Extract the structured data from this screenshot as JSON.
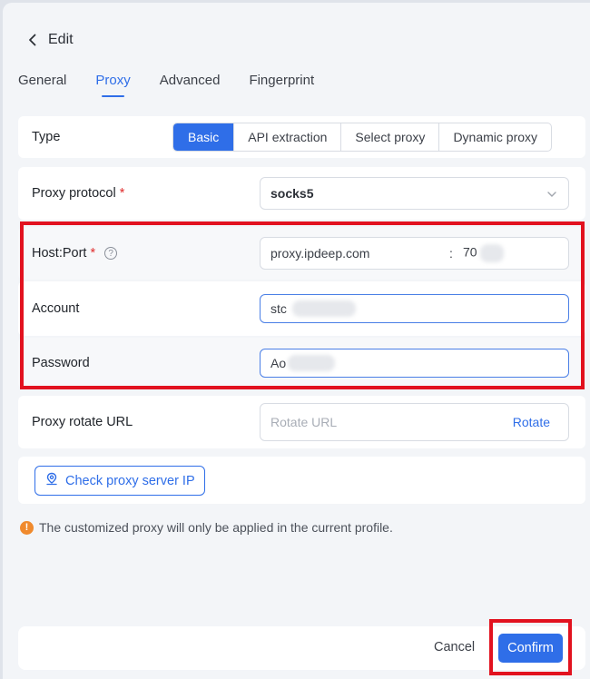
{
  "header": {
    "title": "Edit",
    "back_icon": "chevron-left-icon"
  },
  "tabs": [
    {
      "label": "General",
      "active": false
    },
    {
      "label": "Proxy",
      "active": true
    },
    {
      "label": "Advanced",
      "active": false
    },
    {
      "label": "Fingerprint",
      "active": false
    }
  ],
  "type_row": {
    "label": "Type",
    "options": [
      "Basic",
      "API extraction",
      "Select proxy",
      "Dynamic proxy"
    ],
    "selected": "Basic"
  },
  "protocol_row": {
    "label": "Proxy protocol",
    "required": "*",
    "value": "socks5"
  },
  "host_row": {
    "label": "Host:Port",
    "required": "*",
    "help": "?",
    "host": "proxy.ipdeep.com",
    "separator": ":",
    "port": "70"
  },
  "account_row": {
    "label": "Account",
    "value": "stc"
  },
  "password_row": {
    "label": "Password",
    "value": "Ao"
  },
  "rotate_row": {
    "label": "Proxy rotate URL",
    "placeholder": "Rotate URL",
    "link": "Rotate"
  },
  "check_button": {
    "label": "Check proxy server IP"
  },
  "note": {
    "icon": "!",
    "text": "The customized proxy will only be applied in the current profile."
  },
  "footer": {
    "cancel": "Cancel",
    "confirm": "Confirm"
  },
  "colors": {
    "accent": "#2f6ee8",
    "highlight": "#e2121f",
    "warning": "#f08a2d"
  }
}
